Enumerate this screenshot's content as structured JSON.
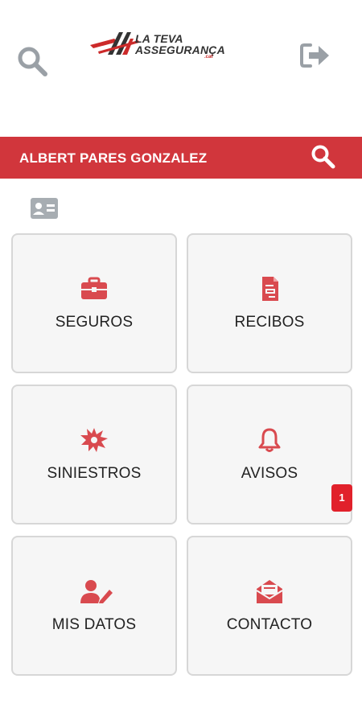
{
  "app": {
    "logo": {
      "line1": "LA TEVA",
      "line2": "ASSEGURANÇA",
      "line3": ".cat"
    }
  },
  "header": {
    "search_icon": "search-icon",
    "logout_icon": "logout-icon"
  },
  "user_bar": {
    "name": "ALBERT PARES GONZALEZ",
    "search_icon": "search-icon",
    "color": "#d1363c"
  },
  "id_card_icon": "id-card-icon",
  "tiles": [
    {
      "label": "SEGUROS",
      "icon": "briefcase-icon"
    },
    {
      "label": "RECIBOS",
      "icon": "receipt-icon"
    },
    {
      "label": "SINIESTROS",
      "icon": "burst-icon"
    },
    {
      "label": "AVISOS",
      "icon": "bell-icon",
      "badge": "1"
    },
    {
      "label": "MIS DATOS",
      "icon": "user-edit-icon"
    },
    {
      "label": "CONTACTO",
      "icon": "envelope-open-icon"
    }
  ],
  "colors": {
    "accent": "#d1363c",
    "icon": "#d94a4f",
    "tile_bg": "#f6f6f6",
    "badge": "#e1212b"
  }
}
